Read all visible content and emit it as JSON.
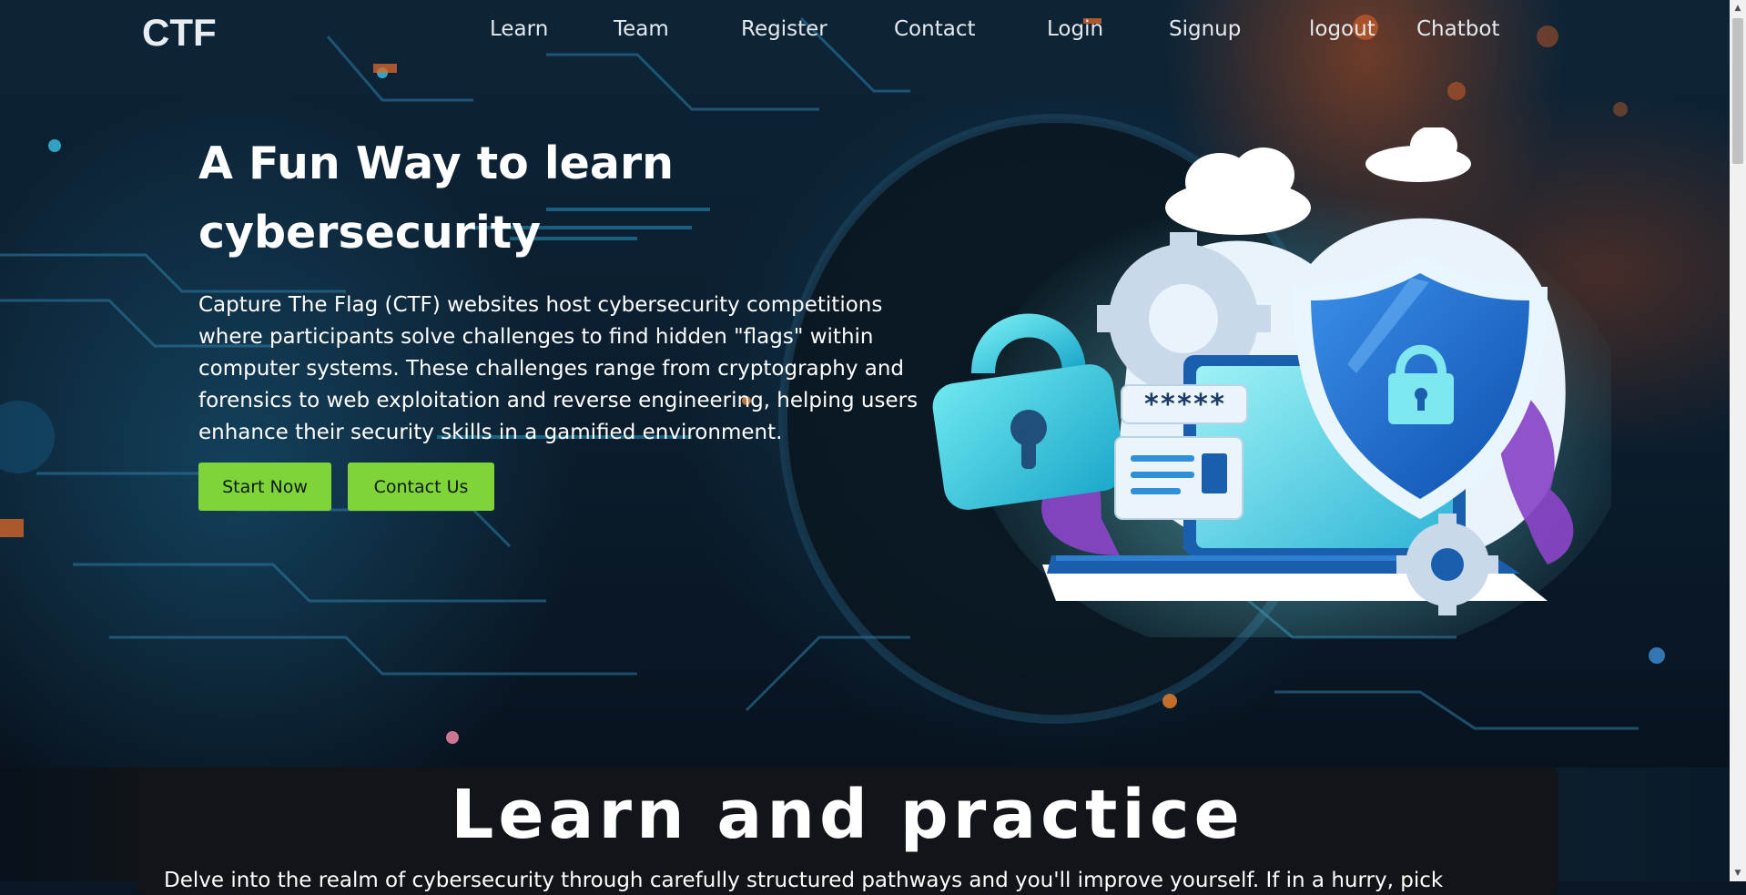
{
  "brand": {
    "logo_text": "CTF"
  },
  "nav": {
    "items": [
      {
        "label": "Learn"
      },
      {
        "label": "Team"
      },
      {
        "label": "Register"
      },
      {
        "label": "Contact"
      },
      {
        "label": "Login"
      },
      {
        "label": "Signup"
      },
      {
        "label": "logout"
      },
      {
        "label": "Chatbot"
      }
    ]
  },
  "hero": {
    "title_line1": "A Fun Way to learn",
    "title_line2": "cybersecurity",
    "description": "Capture The Flag (CTF) websites host cybersecurity competitions where participants solve challenges to find hidden \"flags\" within computer systems. These challenges range from cryptography and forensics to web exploitation and reverse engineering, helping users enhance their security skills in a gamified environment.",
    "primary_button": "Start Now",
    "secondary_button": "Contact Us",
    "password_mask": "*****"
  },
  "section": {
    "title": "Learn and practice",
    "text": "Delve into the realm of cybersecurity through carefully structured pathways and you'll improve yourself. If in a hurry, pick"
  },
  "scrollbar": {
    "up_arrow": "▲",
    "down_arrow": "▼"
  },
  "colors": {
    "accent_green": "#7fd43a",
    "background_dark": "#0b1d2d",
    "card_background": "#111418",
    "shield_blue": "#1e73d6",
    "purple_leaf": "#8a46c8"
  },
  "icons": [
    "lock-icon",
    "shield-icon",
    "gear-icon",
    "cloud-icon",
    "laptop-icon"
  ]
}
